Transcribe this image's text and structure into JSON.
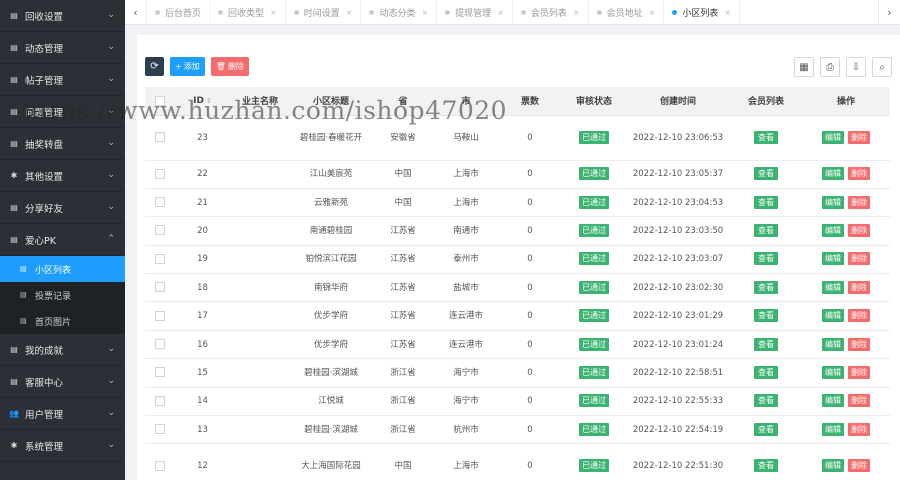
{
  "sidebar": {
    "items_top": [
      {
        "label": "回收设置",
        "icon": "list-icon"
      },
      {
        "label": "动态管理",
        "icon": "list-icon"
      },
      {
        "label": "帖子管理",
        "icon": "list-icon"
      },
      {
        "label": "问题管理",
        "icon": "list-icon"
      },
      {
        "label": "抽奖转盘",
        "icon": "list-icon"
      },
      {
        "label": "其他设置",
        "icon": "gear-icon"
      },
      {
        "label": "分享好友",
        "icon": "list-icon"
      }
    ],
    "open_group": {
      "label": "爱心PK",
      "icon": "list-icon"
    },
    "sub_items": [
      {
        "label": "小区列表",
        "active": true
      },
      {
        "label": "投票记录",
        "active": false
      },
      {
        "label": "首页图片",
        "active": false
      }
    ],
    "items_bottom": [
      {
        "label": "我的成就",
        "icon": "list-icon"
      },
      {
        "label": "客服中心",
        "icon": "list-icon"
      },
      {
        "label": "用户管理",
        "icon": "users-icon"
      },
      {
        "label": "系统管理",
        "icon": "gear-icon"
      }
    ]
  },
  "tabs": [
    {
      "label": "后台首页",
      "closable": false,
      "active": false
    },
    {
      "label": "回收类型",
      "closable": true,
      "active": false
    },
    {
      "label": "时间设置",
      "closable": true,
      "active": false
    },
    {
      "label": "动态分类",
      "closable": true,
      "active": false
    },
    {
      "label": "提现管理",
      "closable": true,
      "active": false
    },
    {
      "label": "会员列表",
      "closable": true,
      "active": false
    },
    {
      "label": "会员地址",
      "closable": true,
      "active": false
    },
    {
      "label": "小区列表",
      "closable": true,
      "active": true
    }
  ],
  "toolbar": {
    "add_label": "添加",
    "delete_label": "删除"
  },
  "table": {
    "headers": [
      "ID",
      "业主名称",
      "小区标题",
      "省",
      "市",
      "票数",
      "审核状态",
      "创建时间",
      "会员列表",
      "操作"
    ],
    "rows": [
      {
        "id": "23",
        "owner": "",
        "title": "碧桂园·春暖花开",
        "province": "安徽省",
        "city": "马鞍山",
        "votes": "0",
        "status": "已通过",
        "created": "2022-12-10 23:06:53",
        "tall": true
      },
      {
        "id": "22",
        "owner": "",
        "title": "江山美宸苑",
        "province": "中国",
        "city": "上海市",
        "votes": "0",
        "status": "已通过",
        "created": "2022-12-10 23:05:37",
        "tall": false
      },
      {
        "id": "21",
        "owner": "",
        "title": "云雅新苑",
        "province": "中国",
        "city": "上海市",
        "votes": "0",
        "status": "已通过",
        "created": "2022-12-10 23:04:53",
        "tall": false
      },
      {
        "id": "20",
        "owner": "",
        "title": "南通碧桂园",
        "province": "江苏省",
        "city": "南通市",
        "votes": "0",
        "status": "已通过",
        "created": "2022-12-10 23:03:50",
        "tall": false
      },
      {
        "id": "19",
        "owner": "",
        "title": "铂悦滨江花园",
        "province": "江苏省",
        "city": "泰州市",
        "votes": "0",
        "status": "已通过",
        "created": "2022-12-10 23:03:07",
        "tall": false
      },
      {
        "id": "18",
        "owner": "",
        "title": "南锦华府",
        "province": "江苏省",
        "city": "盐城市",
        "votes": "0",
        "status": "已通过",
        "created": "2022-12-10 23:02:30",
        "tall": false
      },
      {
        "id": "17",
        "owner": "",
        "title": "优步学府",
        "province": "江苏省",
        "city": "连云港市",
        "votes": "0",
        "status": "已通过",
        "created": "2022-12-10 23:01:29",
        "tall": false
      },
      {
        "id": "16",
        "owner": "",
        "title": "优步学府",
        "province": "江苏省",
        "city": "连云港市",
        "votes": "0",
        "status": "已通过",
        "created": "2022-12-10 23:01:24",
        "tall": false
      },
      {
        "id": "15",
        "owner": "",
        "title": "碧桂园·滨湖城",
        "province": "浙江省",
        "city": "海宁市",
        "votes": "0",
        "status": "已通过",
        "created": "2022-12-10 22:58:51",
        "tall": false
      },
      {
        "id": "14",
        "owner": "",
        "title": "江悦城",
        "province": "浙江省",
        "city": "海宁市",
        "votes": "0",
        "status": "已通过",
        "created": "2022-12-10 22:55:33",
        "tall": false
      },
      {
        "id": "13",
        "owner": "",
        "title": "碧桂园·滨湖城",
        "province": "浙江省",
        "city": "杭州市",
        "votes": "0",
        "status": "已通过",
        "created": "2022-12-10 22:54:19",
        "tall": false
      },
      {
        "id": "12",
        "owner": "",
        "title": "大上海国际花园",
        "province": "中国",
        "city": "上海市",
        "votes": "0",
        "status": "已通过",
        "created": "2022-12-10 22:51:30",
        "tall": true
      }
    ],
    "view_label": "查看",
    "edit_label": "编辑",
    "delete_label": "删除"
  },
  "watermark": "https://www.huzhan.com/ishop47020",
  "colors": {
    "sidebar_bg": "#2b2f36",
    "accent": "#1e9fff",
    "success": "#3cb371",
    "danger": "#f56c6c"
  }
}
